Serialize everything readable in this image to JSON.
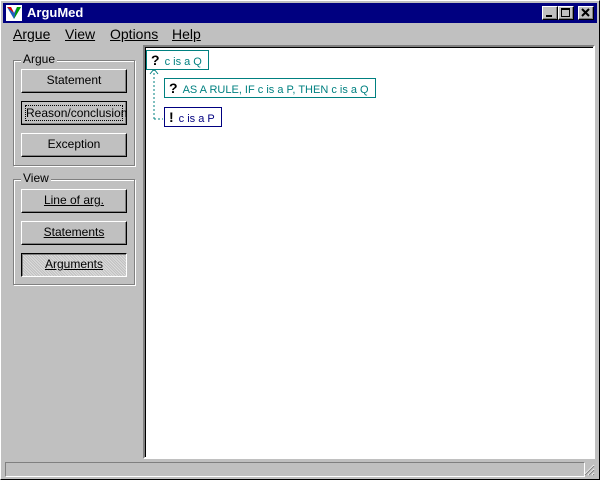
{
  "window": {
    "title": "ArguMed",
    "icon": "argumed-app-icon"
  },
  "menu": [
    {
      "label": "Argue"
    },
    {
      "label": "View"
    },
    {
      "label": "Options"
    },
    {
      "label": "Help"
    }
  ],
  "argue_group": {
    "label": "Argue",
    "buttons": [
      {
        "label": "Statement"
      },
      {
        "label": "Reason/conclusion"
      },
      {
        "label": "Exception"
      }
    ]
  },
  "view_group": {
    "label": "View",
    "buttons": [
      {
        "label": "Line of arg."
      },
      {
        "label": "Statements"
      },
      {
        "label": "Arguments"
      }
    ]
  },
  "canvas": {
    "nodes": [
      {
        "mark": "?",
        "text": "c is a Q",
        "color": "#008080"
      },
      {
        "mark": "?",
        "text": "AS A RULE, IF c is a P, THEN c is a Q",
        "color": "#008080"
      },
      {
        "mark": "!",
        "text": "c is a P",
        "color": "#000080"
      }
    ]
  },
  "colors": {
    "titlebar": "#000080",
    "face": "#c0c0c0",
    "teal_text": "#008080",
    "navy_text": "#000080"
  }
}
